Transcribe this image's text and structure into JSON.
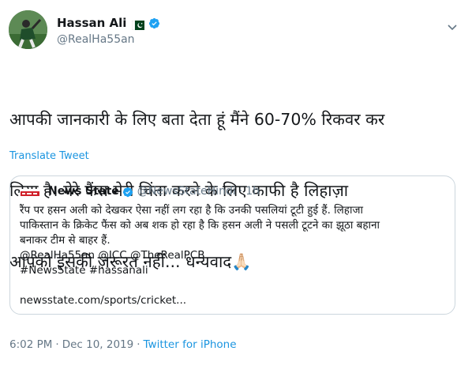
{
  "user": {
    "display_name": "Hassan Ali",
    "handle": "@RealHa55an",
    "verified": true,
    "flag": "pakistan-flag-icon"
  },
  "tweet": {
    "lines": [
      "आपकी जानकारी के लिए बता देता हूं मैंने 60-70% रिकवर कर",
      "लिया है। मेरे फैंस मेरी चिंता करने के लिए काफी है लिहाज़ा",
      "आपको इसकी ज़रूरत नहीं... धन्यवाद🙏🏻"
    ],
    "translate_label": "Translate Tweet"
  },
  "quoted": {
    "name": "News State",
    "handle": "@NewsStateHindi",
    "dot": "·",
    "time": "1h",
    "lines": [
      "रैंप पर हसन अली को देखकर ऐसा नहीं लग रहा है कि उनकी पसलियां टूटी हुई हैं. लिहाजा",
      "पाकिस्तान के क्रिकेट फैंस को अब शक हो रहा है कि हसन अली ने पसली टूटने का झूठा बहाना",
      "बनाकर टीम से बाहर हैं.",
      "@RealHa55an @ICC @TheRealPCB",
      "#NewsState #hassanali",
      "newsstate.com/sports/cricket..."
    ]
  },
  "meta": {
    "time": "6:02 PM",
    "sep1": "·",
    "date": "Dec 10, 2019",
    "sep2": "·",
    "source": "Twitter for iPhone"
  },
  "colors": {
    "link": "#1b95e0",
    "muted": "#657786",
    "verified": "#1da1f2",
    "border": "#ccd6dd"
  }
}
